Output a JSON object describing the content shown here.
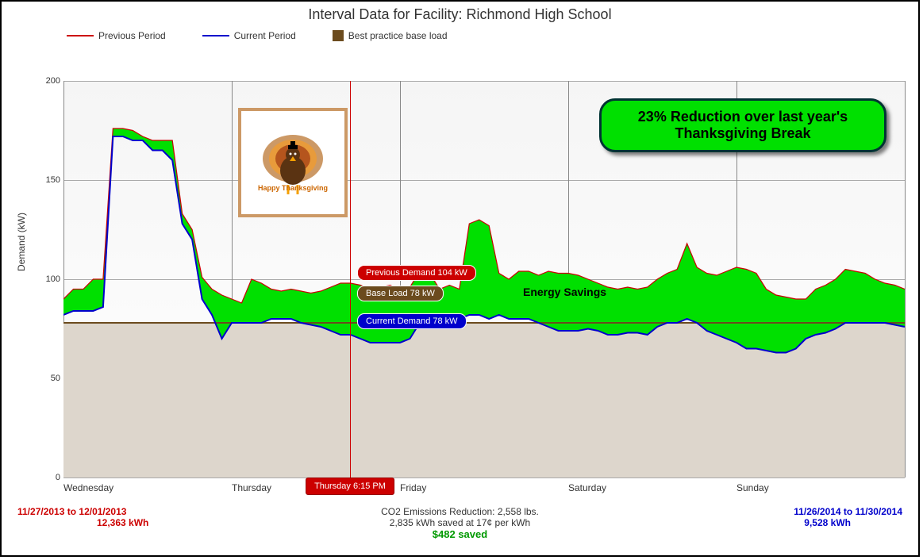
{
  "title": "Interval Data for Facility: Richmond High School",
  "legend": {
    "previous": "Previous Period",
    "current": "Current Period",
    "baseload": "Best practice base load"
  },
  "ylabel": "Demand (kW)",
  "cursor": {
    "time_label": "Thursday 6:15 PM",
    "previous_badge": "Previous Demand 104 kW",
    "baseload_badge": "Base Load 78 kW",
    "current_badge": "Current Demand 78 kW"
  },
  "energy_savings_label": "Energy Savings",
  "reduction_box": "23% Reduction over last year's Thanksgiving Break",
  "turkey_caption": "Happy Thanksgiving",
  "left_period": {
    "range": "11/27/2013 to 12/01/2013",
    "kwh": "12,363 kWh"
  },
  "right_period": {
    "range": "11/26/2014 to 11/30/2014",
    "kwh": "9,528 kWh"
  },
  "footer": {
    "co2": "CO2 Emissions Reduction: 2,558 lbs.",
    "kwh_saved": "2,835 kWh saved at 17¢ per kWh",
    "dollars_saved": "$482 saved"
  },
  "chart_data": {
    "type": "line",
    "xlabel": "",
    "ylabel": "Demand (kW)",
    "ylim": [
      0,
      200
    ],
    "y_ticks": [
      0,
      50,
      100,
      150,
      200
    ],
    "x_categories": [
      "Wednesday",
      "Thursday",
      "Friday",
      "Saturday",
      "Sunday"
    ],
    "baseline_kW": 78,
    "cursor_time": "Thursday 6:15 PM",
    "series": [
      {
        "name": "Previous Period",
        "color": "#cc0000",
        "values": [
          90,
          95,
          95,
          100,
          100,
          176,
          176,
          175,
          172,
          170,
          170,
          170,
          133,
          125,
          101,
          95,
          92,
          90,
          88,
          100,
          98,
          95,
          94,
          95,
          94,
          93,
          94,
          96,
          98,
          98,
          97,
          95,
          96,
          97,
          95,
          96,
          104,
          103,
          95,
          97,
          95,
          128,
          130,
          127,
          103,
          100,
          104,
          104,
          102,
          104,
          103,
          103,
          102,
          100,
          98,
          96,
          95,
          96,
          95,
          96,
          100,
          103,
          105,
          118,
          106,
          103,
          102,
          104,
          106,
          105,
          103,
          95,
          92,
          91,
          90,
          90,
          95,
          97,
          100,
          105,
          104,
          103,
          100,
          98,
          97,
          95
        ]
      },
      {
        "name": "Current Period",
        "color": "#0000cc",
        "values": [
          82,
          84,
          84,
          84,
          86,
          172,
          172,
          170,
          170,
          165,
          165,
          160,
          128,
          120,
          90,
          82,
          70,
          78,
          78,
          78,
          78,
          80,
          80,
          80,
          78,
          77,
          76,
          74,
          72,
          72,
          70,
          68,
          68,
          68,
          68,
          70,
          78,
          78,
          76,
          78,
          80,
          82,
          82,
          80,
          82,
          80,
          80,
          80,
          78,
          76,
          74,
          74,
          74,
          75,
          74,
          72,
          72,
          73,
          73,
          72,
          76,
          78,
          78,
          80,
          78,
          74,
          72,
          70,
          68,
          65,
          65,
          64,
          63,
          63,
          65,
          70,
          72,
          73,
          75,
          78,
          78,
          78,
          78,
          78,
          77,
          76
        ]
      },
      {
        "name": "Best practice base load",
        "color": "#6b4b1e",
        "constant": 78
      }
    ]
  }
}
